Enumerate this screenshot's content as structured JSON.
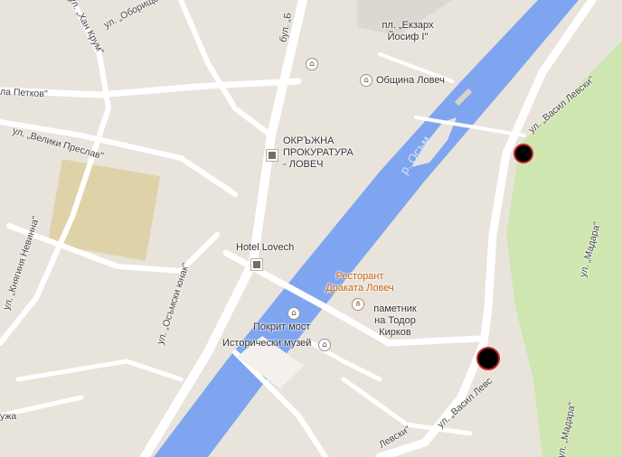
{
  "map": {
    "river_label": "р. Осъм",
    "streets": {
      "obor": "ул. „Оборище\"",
      "han_krum": "ул. „Хан Крум\"",
      "bul": "бул. „Б",
      "la_petkov": "ла Петков\"",
      "veliki_preslav": "ул. „Велики Преслав\"",
      "knyaginya": "ул. „Княгиня Невинна\"",
      "osmski": "ул. „Осъмски юнак\"",
      "vasil_levski_top": "ул. „Васил Левски\"",
      "vasil_levski_bottom": "ул. „Васил Левс",
      "levski_bottom": "Левски\"",
      "madara_upper": "ул. „Мадара\"",
      "madara_lower": "ул. „Мадара\"",
      "left_edge": "ужа"
    },
    "places": {
      "ekzarh": "пл. „Екзарх Йосиф I\"",
      "obshtina": "Община Ловеч",
      "prokuratura": "ОКРЪЖНА ПРОКУРАТУРА - ЛОВЕЧ",
      "hotel": "Hotel Lovech",
      "restaurant": "Ресторант Дракатa Ловеч",
      "monument": "паметник на Тодор Кирков",
      "bridge": "Покрит мост",
      "museum": "Исторически музей"
    },
    "icons": {
      "museum_top": "museum-icon",
      "obshtina": "government-icon",
      "restaurant": "restaurant-icon",
      "bridge": "landmark-icon",
      "museum": "museum-icon"
    },
    "colors": {
      "land": "#e8e4dc",
      "road": "#ffffff",
      "water": "#7fa5f0",
      "park": "#cfe6b0",
      "marker": "#000000"
    }
  }
}
